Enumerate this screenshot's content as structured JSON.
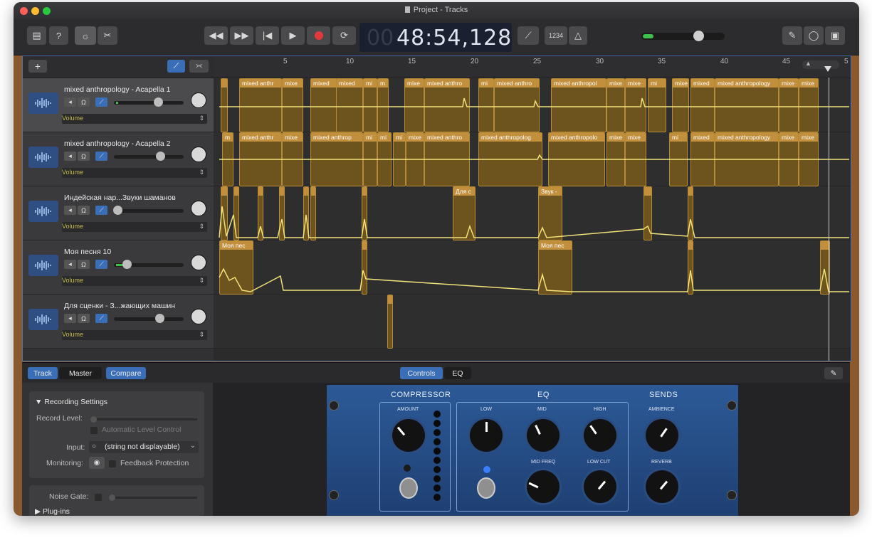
{
  "window": {
    "title": "Project - Tracks"
  },
  "toolbar": {
    "lcd_ghost": "00",
    "lcd_time": "48:54,128",
    "count_in_label": "1234"
  },
  "ruler": {
    "ticks": [
      "5",
      "10",
      "15",
      "20",
      "25",
      "30",
      "35",
      "40",
      "45",
      "5"
    ]
  },
  "tracks": [
    {
      "name": "mixed anthropology - Acapella 1",
      "automation": "Volume"
    },
    {
      "name": "mixed anthropology - Acapella 2",
      "automation": "Volume"
    },
    {
      "name": "Индейская нар...Звуки шаманов",
      "automation": "Volume"
    },
    {
      "name": "Моя песня 10",
      "automation": "Volume"
    },
    {
      "name": "Для сценки - З...жающих машин",
      "automation": "Volume"
    }
  ],
  "regions": {
    "r1_labels": [
      "mixed anthr",
      "mixe",
      "mixed",
      "mixed",
      "mi",
      "m",
      "mixe",
      "mixed anthro",
      "mi",
      "mixed anthro",
      "mixed anthropol",
      "mixe",
      "mixe",
      "mi",
      "mixe",
      "mixed",
      "mixed anthropology",
      "mixe",
      "mixe"
    ],
    "r2_labels": [
      "m",
      "mixed anthr",
      "mixe",
      "mixed anthrop",
      "mi",
      "mi",
      "mi",
      "mixe",
      "mixed anthro",
      "mixed anthropolog",
      "mixed anthropolo",
      "mixe",
      "mixe",
      "mi",
      "mixed",
      "mixed anthropology",
      "mixe",
      "mixe"
    ],
    "r3_labels": [
      "Для с",
      "Звук -"
    ],
    "r4_labels": [
      "Моя пес",
      "Моя пес"
    ]
  },
  "bottom": {
    "tabs": [
      "Track",
      "Master",
      "Compare"
    ],
    "view_tabs": [
      "Controls",
      "EQ"
    ],
    "recording_settings": "Recording Settings",
    "record_level": "Record Level:",
    "auto_level": "Automatic Level Control",
    "input_label": "Input:",
    "input_value": "(string not displayable)",
    "monitoring_label": "Monitoring:",
    "feedback": "Feedback Protection",
    "noise_gate": "Noise Gate:",
    "plugins": "Plug-ins"
  },
  "plugin": {
    "compressor": "COMPRESSOR",
    "eq": "EQ",
    "sends": "SENDS",
    "amount": "AMOUNT",
    "low": "LOW",
    "mid": "MID",
    "high": "HIGH",
    "ambience": "AMBIENCE",
    "mid_freq": "MID FREQ",
    "low_cut": "LOW CUT",
    "reverb": "REVERB"
  },
  "colors": {
    "accent": "#3a6fb8",
    "region": "#c28f3c",
    "automation": "#f1e27a"
  }
}
